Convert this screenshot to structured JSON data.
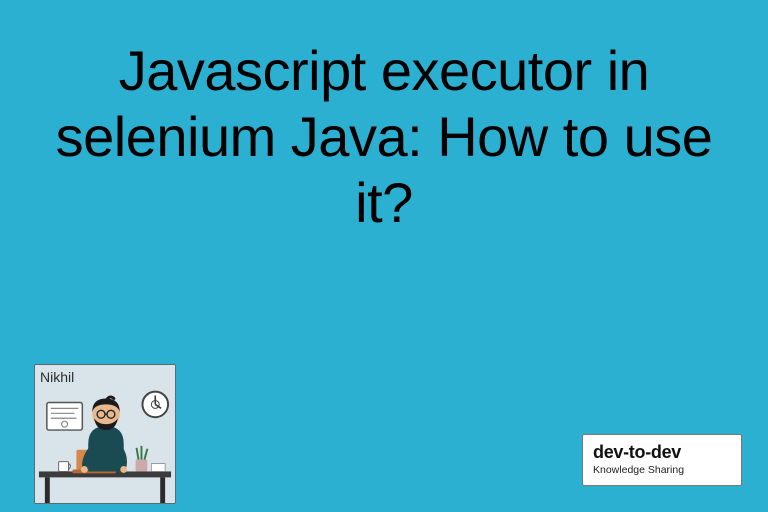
{
  "title": "Javascript executor in selenium Java: How to use it?",
  "author": {
    "name": "Nikhil"
  },
  "brand": {
    "title": "dev-to-dev",
    "subtitle": "Knowledge Sharing"
  },
  "colors": {
    "background": "#2cb0d1",
    "text": "#000000",
    "card_bg": "#ffffff"
  }
}
